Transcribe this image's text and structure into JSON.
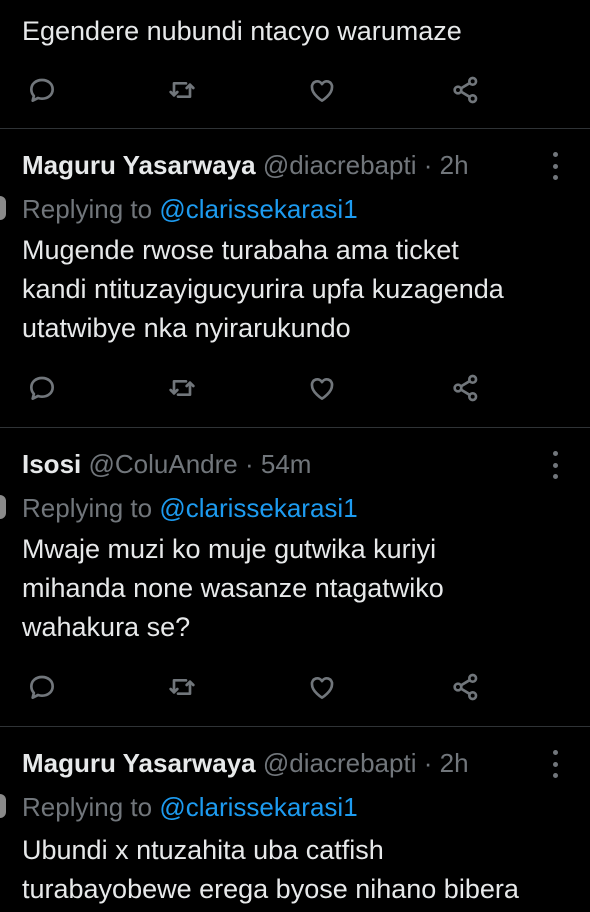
{
  "tweets": [
    {
      "text_lines": [
        "Egendere nubundi ntacyo warumaze"
      ]
    },
    {
      "name": "Maguru Yasarwaya",
      "handle": "@diacrebapti",
      "time": "2h",
      "replying_prefix": "Replying to",
      "replying_to": "@clarissekarasi1",
      "text_lines": [
        "Mugende rwose turabaha ama ticket",
        "kandi ntituzayigucyurira upfa kuzagenda",
        "utatwibye nka nyirarukundo"
      ]
    },
    {
      "name": "Isosi",
      "handle": "@ColuAndre",
      "time": "54m",
      "replying_prefix": "Replying to",
      "replying_to": "@clarissekarasi1",
      "text_lines": [
        "Mwaje muzi ko muje gutwika kuriyi",
        "mihanda none wasanze ntagatwiko",
        "wahakura se?"
      ]
    },
    {
      "name": "Maguru Yasarwaya",
      "handle": "@diacrebapti",
      "time": "2h",
      "replying_prefix": "Replying to",
      "replying_to": "@clarissekarasi1",
      "text_lines": [
        "Ubundi x ntuzahita uba catfish",
        "turabayobewe erega byose nihano bibera"
      ]
    }
  ],
  "separator": "·",
  "colors": {
    "background": "#000000",
    "text": "#e7e9ea",
    "muted": "#71767b",
    "link": "#1d9bf0",
    "divider": "#2f3336"
  },
  "icons": [
    "reply-icon",
    "retweet-icon",
    "like-icon",
    "share-icon",
    "more-icon"
  ]
}
